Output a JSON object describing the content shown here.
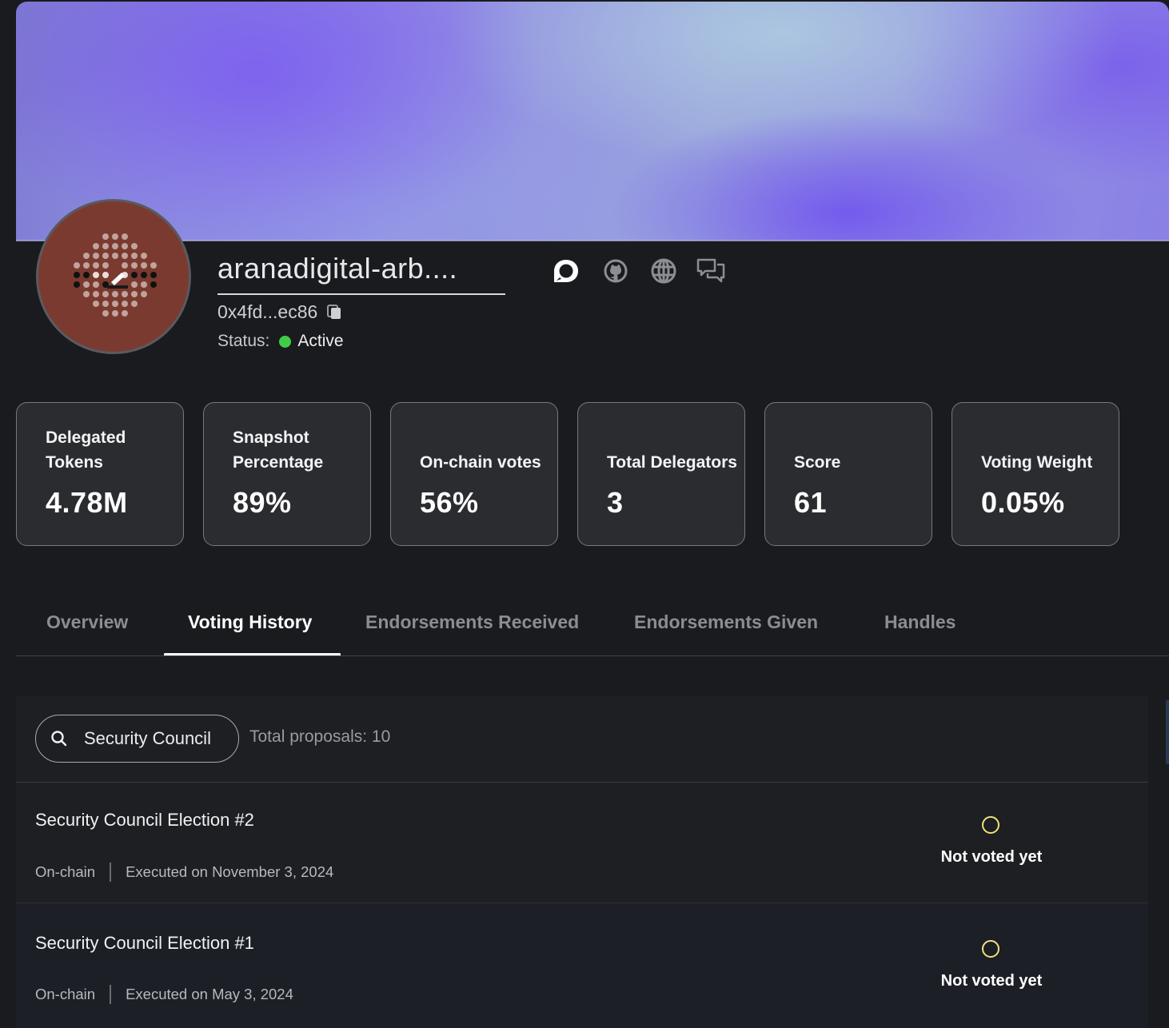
{
  "profile": {
    "name": "aranadigital-arb....",
    "address": "0x4fd...ec86",
    "status_label": "Status:",
    "status_value": "Active",
    "social_icons": [
      "discourse-icon",
      "github-icon",
      "globe-icon",
      "forum-chat-icon"
    ]
  },
  "stats": [
    {
      "label": "Delegated Tokens",
      "value": "4.78M"
    },
    {
      "label": "Snapshot Percentage",
      "value": "89%"
    },
    {
      "label": "On-chain votes",
      "value": "56%"
    },
    {
      "label": "Total Delegators",
      "value": "3"
    },
    {
      "label": "Score",
      "value": "61"
    },
    {
      "label": "Voting Weight",
      "value": "0.05%"
    }
  ],
  "tabs": [
    {
      "label": "Overview",
      "active": false
    },
    {
      "label": "Voting History",
      "active": true
    },
    {
      "label": "Endorsements Received",
      "active": false
    },
    {
      "label": "Endorsements Given",
      "active": false
    },
    {
      "label": "Handles",
      "active": false
    }
  ],
  "voting_history": {
    "search_value": "Security Council",
    "total_label": "Total proposals: 10",
    "proposals": [
      {
        "title": "Security Council Election #2",
        "type": "On-chain",
        "executed": "Executed on November 3, 2024",
        "vote": "Not voted yet"
      },
      {
        "title": "Security Council Election #1",
        "type": "On-chain",
        "executed": "Executed on May 3, 2024",
        "vote": "Not voted yet"
      }
    ]
  },
  "colors": {
    "background": "#1a1b1e",
    "card": "#2b2c30",
    "status_active": "#3fcd47",
    "vote_pending": "#f1e27a"
  }
}
